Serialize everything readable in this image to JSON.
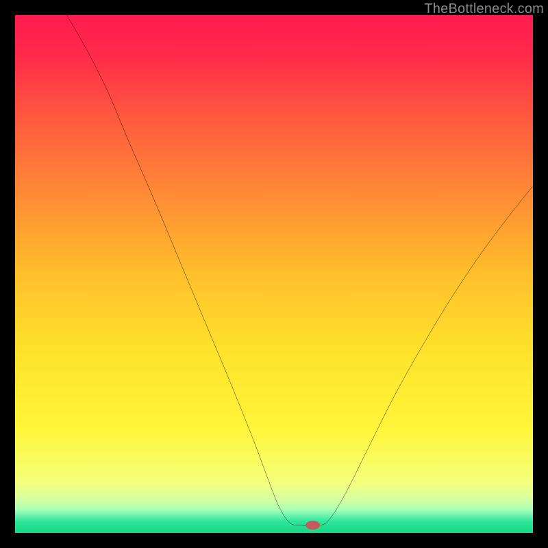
{
  "watermark": {
    "text": "TheBottleneck.com"
  },
  "chart_data": {
    "type": "line",
    "title": "",
    "xlabel": "",
    "ylabel": "",
    "xlim": [
      0,
      100
    ],
    "ylim": [
      0,
      100
    ],
    "grid": false,
    "legend": false,
    "annotations": [],
    "axis_ticks": {
      "x": [],
      "y": []
    },
    "series": [
      {
        "name": "bottleneck-curve",
        "color": "#000000",
        "points": [
          {
            "x": 10,
            "y": 100
          },
          {
            "x": 14,
            "y": 93
          },
          {
            "x": 18,
            "y": 85
          },
          {
            "x": 22,
            "y": 75.5
          },
          {
            "x": 27,
            "y": 64
          },
          {
            "x": 32,
            "y": 52
          },
          {
            "x": 37,
            "y": 40
          },
          {
            "x": 42,
            "y": 28
          },
          {
            "x": 46,
            "y": 18
          },
          {
            "x": 49,
            "y": 10
          },
          {
            "x": 51,
            "y": 5
          },
          {
            "x": 53,
            "y": 2
          },
          {
            "x": 55,
            "y": 1.5
          },
          {
            "x": 59,
            "y": 1.5
          },
          {
            "x": 61,
            "y": 3
          },
          {
            "x": 64,
            "y": 8
          },
          {
            "x": 68,
            "y": 16
          },
          {
            "x": 73,
            "y": 26
          },
          {
            "x": 78,
            "y": 35
          },
          {
            "x": 84,
            "y": 45
          },
          {
            "x": 90,
            "y": 54
          },
          {
            "x": 96,
            "y": 62
          },
          {
            "x": 100,
            "y": 67
          }
        ]
      }
    ],
    "marker": {
      "name": "optimal-marker",
      "x": 57.5,
      "y": 1.5,
      "color": "#c75a5a"
    },
    "background_gradient": {
      "stops": [
        {
          "offset": 0.0,
          "color": "#ff1a4f"
        },
        {
          "offset": 0.08,
          "color": "#ff2b49"
        },
        {
          "offset": 0.2,
          "color": "#ff5a3f"
        },
        {
          "offset": 0.35,
          "color": "#ff8c35"
        },
        {
          "offset": 0.5,
          "color": "#ffbf2b"
        },
        {
          "offset": 0.65,
          "color": "#ffe22b"
        },
        {
          "offset": 0.8,
          "color": "#fff53a"
        },
        {
          "offset": 0.9,
          "color": "#f4ff7a"
        },
        {
          "offset": 0.935,
          "color": "#d7ffa0"
        },
        {
          "offset": 0.955,
          "color": "#a8ffb5"
        },
        {
          "offset": 0.965,
          "color": "#70f5b2"
        },
        {
          "offset": 0.978,
          "color": "#2ee59a"
        },
        {
          "offset": 1.0,
          "color": "#15d885"
        }
      ]
    }
  }
}
